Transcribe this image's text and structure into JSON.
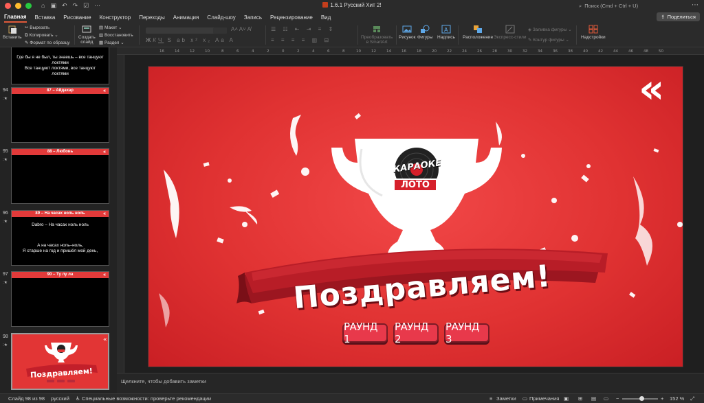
{
  "app": {
    "doc_title": "1.6.1 Русский Хит 2!",
    "search_placeholder": "Поиск (Cmd + Ctrl + U)",
    "share_label": "Поделиться"
  },
  "tabs": [
    "Главная",
    "Вставка",
    "Рисование",
    "Конструктор",
    "Переходы",
    "Анимация",
    "Слайд-шоу",
    "Запись",
    "Рецензирование",
    "Вид"
  ],
  "ribbon": {
    "paste": "Вставить",
    "cut": "Вырезать",
    "copy": "Копировать",
    "format_painter": "Формат по образцу",
    "new_slide_1": "Создать",
    "new_slide_2": "слайд",
    "layout": "Макет",
    "reset": "Восстановить",
    "section": "Раздел",
    "smartart_1": "Преобразовать",
    "smartart_2": "в SmartArt",
    "picture": "Рисунок",
    "shapes": "Фигуры",
    "textbox": "Надпись",
    "arrange": "Расположение",
    "quick_styles": "Экспресс-стили",
    "shape_fill": "Заливка фигуры",
    "shape_outline": "Контур фигуры",
    "addins": "Надстройки"
  },
  "thumbnails": [
    {
      "number": "",
      "lines": [
        "Где бы я не был, ты знаешь – все танцуют",
        "локтями",
        "Все танцуют локтями, все танцуют",
        "локтями"
      ]
    },
    {
      "number": "94",
      "title": "87 – Айдахар",
      "lines": []
    },
    {
      "number": "95",
      "title": "88 – Любовь",
      "lines": []
    },
    {
      "number": "96",
      "title": "89 – На часах ноль ноль",
      "lines": [
        "Dabro – На часах ноль ноль",
        "",
        "",
        "А на часах ноль–ноль,",
        "Я старше на год и пришёл мой день,"
      ]
    },
    {
      "number": "97",
      "title": "90 – Ту лу ла",
      "lines": []
    },
    {
      "number": "98",
      "title": "",
      "lines": []
    }
  ],
  "slide": {
    "back_chevron": "«",
    "logo_top": "КАРАОКЕ",
    "logo_bottom": "ЛОТО",
    "banner": "Поздравляем!",
    "buttons": [
      "РАУНД 1",
      "РАУНД 2",
      "РАУНД 3"
    ]
  },
  "notes": {
    "placeholder": "Щелкните, чтобы добавить заметки"
  },
  "status": {
    "slide_counter": "Слайд 98 из 98",
    "language": "русский",
    "accessibility": "Специальные возможности: проверьте рекомендации",
    "notes": "Заметки",
    "comments": "Примечания",
    "zoom": "152 %"
  },
  "colors": {
    "slide_red": "#e03232",
    "button_red": "#e8394b",
    "accent": "#e05a3a"
  }
}
